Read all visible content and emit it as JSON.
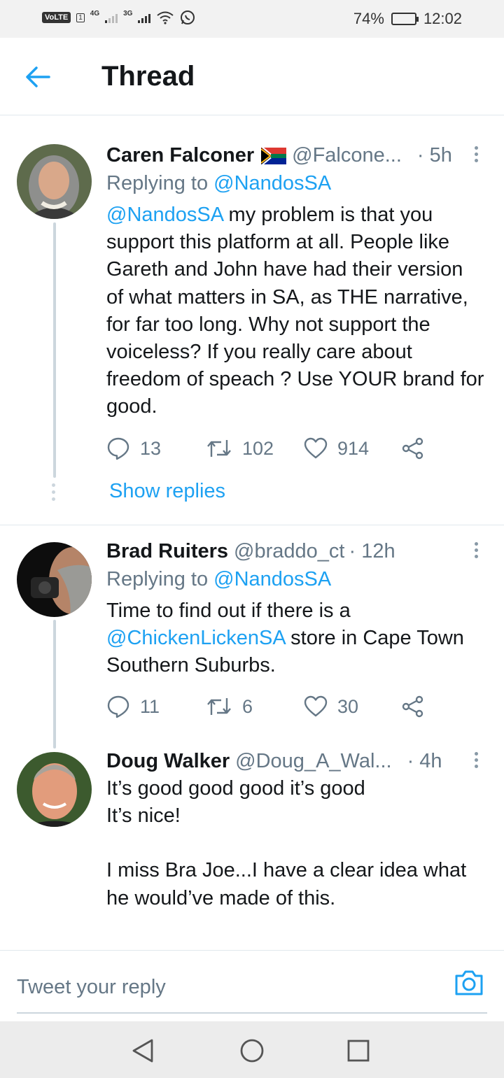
{
  "status_bar": {
    "volte": "VoLTE",
    "sim": "1",
    "net1": "4G",
    "net2": "3G",
    "battery": "74%",
    "battery_level": 0.74,
    "time": "12:02"
  },
  "header": {
    "back_icon": "arrow-left-icon",
    "title": "Thread"
  },
  "tweets": [
    {
      "name": "Caren Falconer",
      "flag": "south-africa-flag",
      "handle": "@Falcone...",
      "time": "· 5h",
      "reply_prefix": "Replying to ",
      "reply_to": "@NandosSA",
      "text_mention": "@NandosSA",
      "text": " my problem  is that you support this platform at all. People like Gareth and John  have had their version of what matters in SA, as THE narrative, for far too long. Why not support the voiceless? If you really care about freedom of speach ? Use YOUR brand for good.",
      "replies": "13",
      "retweets": "102",
      "likes": "914"
    },
    {
      "name": "Brad Ruiters",
      "handle": "@braddo_ct",
      "time": "· 12h",
      "reply_prefix": "Replying to ",
      "reply_to": "@NandosSA",
      "text_before": "Time to find out if there is a ",
      "text_mention": "@ChickenLickenSA",
      "text_after": " store in Cape Town Southern Suburbs.",
      "replies": "11",
      "retweets": "6",
      "likes": "30"
    },
    {
      "name": "Doug Walker",
      "handle": "@Doug_A_Wal...",
      "time": "· 4h",
      "line1": "It’s good good good it’s good",
      "line2": "It’s nice!",
      "line3": "I miss Bra Joe...I have a clear idea what he would’ve made of this."
    }
  ],
  "show_replies": "Show replies",
  "composer": {
    "placeholder": "Tweet your reply",
    "camera_icon": "camera-icon"
  },
  "nav": {
    "back": "nav-back-icon",
    "home": "nav-home-icon",
    "recents": "nav-recents-icon"
  },
  "colors": {
    "accent": "#1da1f2",
    "muted": "#657786",
    "text": "#14171a",
    "divider": "#e1e8ed"
  }
}
